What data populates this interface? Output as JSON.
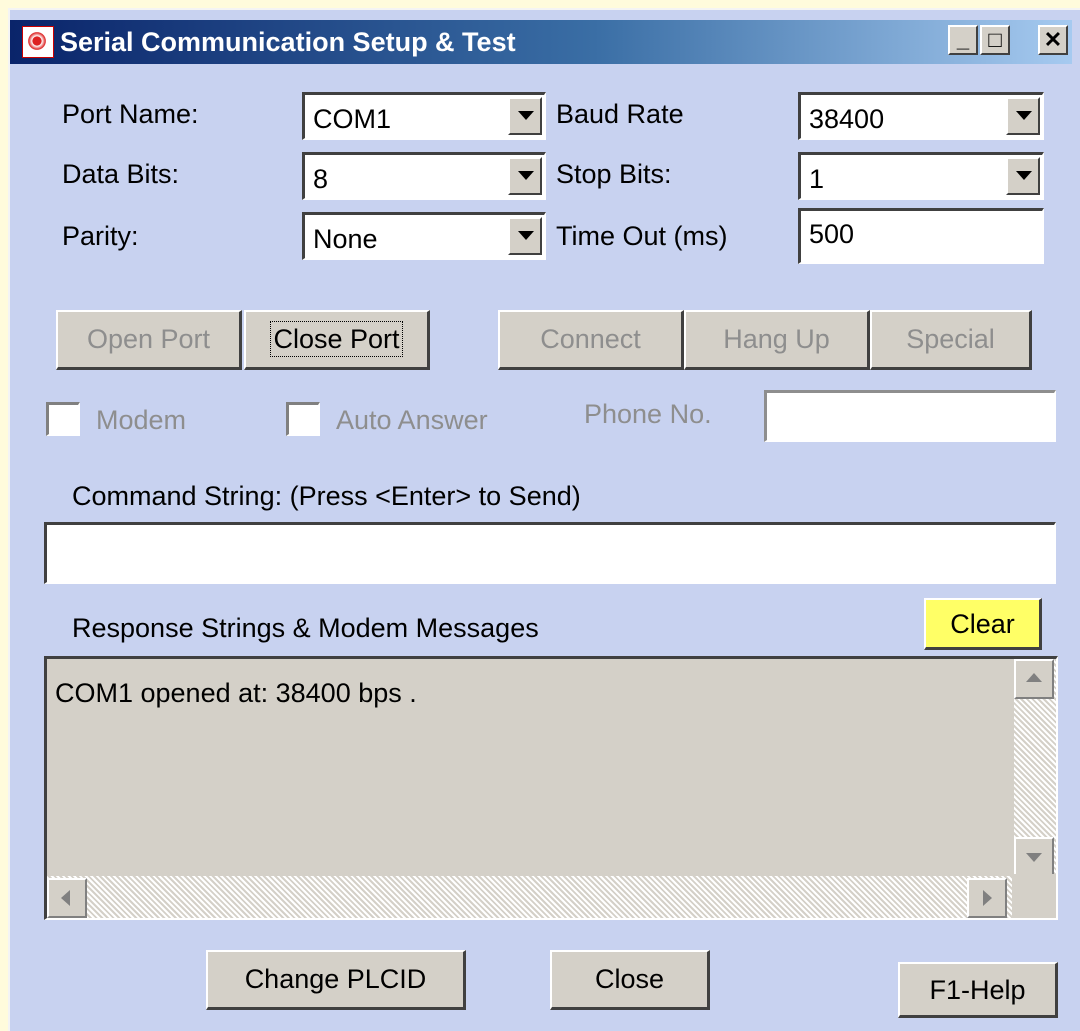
{
  "window": {
    "title": "Serial Communication Setup & Test",
    "controls": {
      "minimize": "_",
      "maximize": "□",
      "close": "✕"
    }
  },
  "settings": {
    "port_name_label": "Port Name:",
    "port_name_value": "COM1",
    "baud_rate_label": "Baud Rate",
    "baud_rate_value": "38400",
    "data_bits_label": "Data Bits:",
    "data_bits_value": "8",
    "stop_bits_label": "Stop Bits:",
    "stop_bits_value": "1",
    "parity_label": "Parity:",
    "parity_value": "None",
    "timeout_label": "Time Out (ms)",
    "timeout_value": "500"
  },
  "buttons": {
    "open_port": "Open Port",
    "close_port": "Close Port",
    "connect": "Connect",
    "hang_up": "Hang Up",
    "special": "Special",
    "clear": "Clear",
    "change_plcid": "Change PLCID",
    "close": "Close",
    "help": "F1-Help"
  },
  "modem": {
    "modem_label": "Modem",
    "modem_checked": false,
    "auto_answer_label": "Auto Answer",
    "auto_answer_checked": false,
    "phone_label": "Phone No.",
    "phone_value": ""
  },
  "command": {
    "label": "Command String: (Press <Enter> to Send)",
    "value": ""
  },
  "response": {
    "label": "Response Strings & Modem Messages",
    "text": "COM1 opened at: 38400 bps ."
  },
  "colors": {
    "window_bg": "#c8d2f0",
    "titlebar_start": "#0a246a",
    "titlebar_end": "#a6caf0",
    "clear_button": "#ffff66"
  }
}
